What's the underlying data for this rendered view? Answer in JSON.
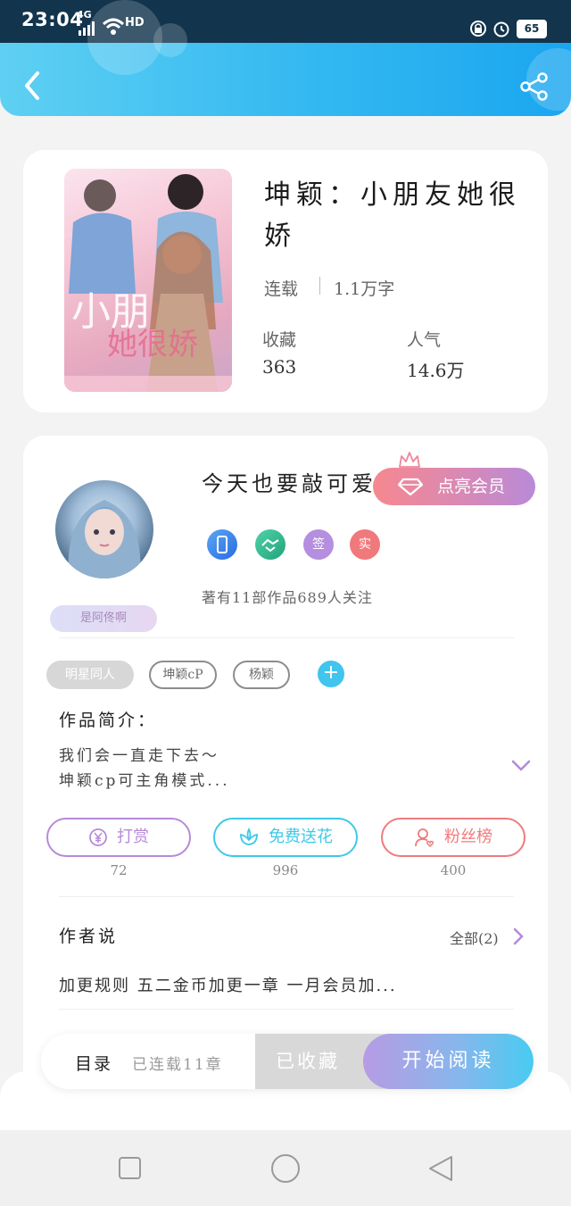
{
  "status_bar": {
    "time": "23:04",
    "network": "4G",
    "hd": "HD",
    "battery": "65"
  },
  "header": {
    "back_icon": "chevron-left-icon",
    "share_icon": "share-icon"
  },
  "book": {
    "title": "坤颖：小朋友她很娇",
    "status": "连载",
    "word_count": "1.1万字",
    "favorites_label": "收藏",
    "favorites_value": "363",
    "popularity_label": "人气",
    "popularity_value": "14.6万"
  },
  "author": {
    "name": "今天也要敲可爱",
    "vip_button": "点亮会员",
    "badges": [
      "",
      "",
      "签",
      "实"
    ],
    "stats": "著有11部作品689人关注",
    "signature": "是阿佟啊"
  },
  "tags": [
    "明星同人",
    "坤颖cP",
    "杨颖"
  ],
  "intro": {
    "title": "作品简介：",
    "lines": [
      "我们会一直走下去～",
      "坤颖cp可主角模式..."
    ]
  },
  "actions": [
    {
      "label": "打赏",
      "count": "72",
      "icon": "yen-icon",
      "color": "#b68ad8"
    },
    {
      "label": "免费送花",
      "count": "996",
      "icon": "flower-icon",
      "color": "#3fc8e8"
    },
    {
      "label": "粉丝榜",
      "count": "400",
      "icon": "fan-ranking-icon",
      "color": "#ef7b7e"
    }
  ],
  "author_say": {
    "title": "作者说",
    "all_label": "全部(2)",
    "text": "加更规则 五二金币加更一章 一月会员加..."
  },
  "bottom_bar": {
    "toc_label": "目录",
    "toc_status": "已连载11章",
    "favorited_button": "已收藏",
    "read_button": "开始阅读"
  }
}
